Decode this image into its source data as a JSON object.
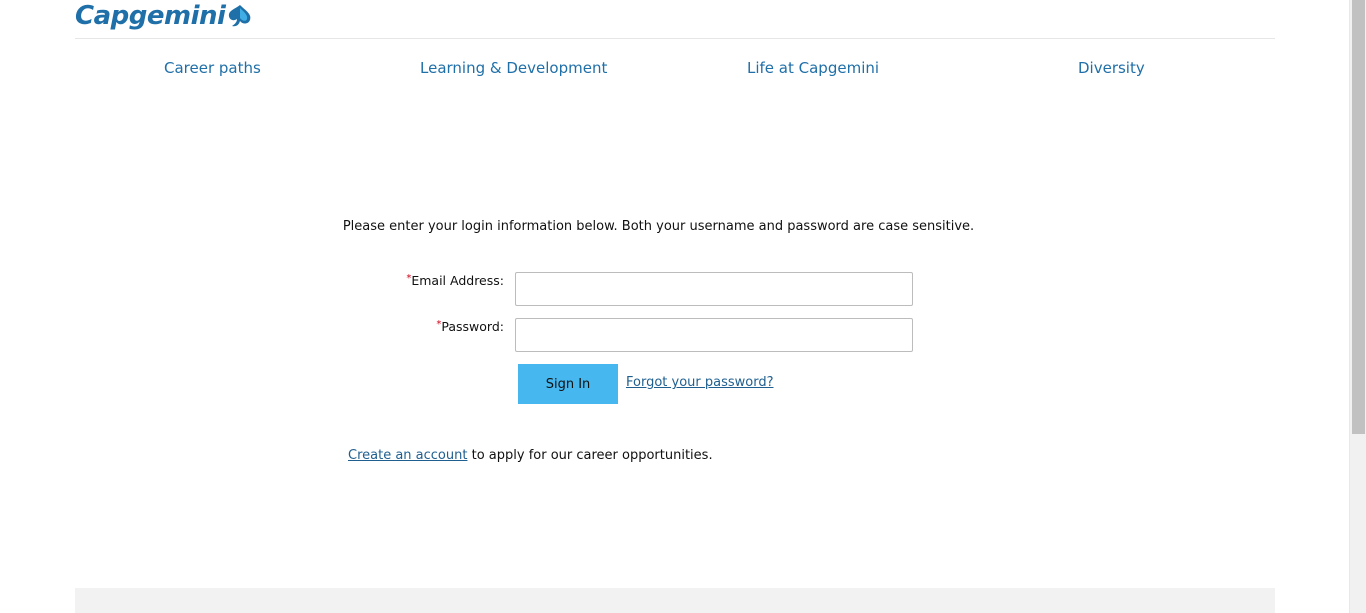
{
  "brand": {
    "logo_text": "Capgemini",
    "color": "#1f6fa8"
  },
  "nav": {
    "items": [
      {
        "label": "Career paths"
      },
      {
        "label": "Learning & Development"
      },
      {
        "label": "Life at Capgemini"
      },
      {
        "label": "Diversity"
      }
    ]
  },
  "login": {
    "intro": "Please enter your login information below. Both your username and password are case sensitive.",
    "required_marker": "*",
    "email_label": "Email Address:",
    "email_value": "",
    "password_label": "Password:",
    "password_value": "",
    "signin_label": "Sign In",
    "forgot_label": "Forgot your password?",
    "create_account_label": "Create an account",
    "create_account_suffix": " to apply for our career opportunities."
  },
  "colors": {
    "accent_button": "#46b8ef",
    "link": "#1f5f8f",
    "required": "#d0021b"
  },
  "icons": {
    "logo_mark": "spade-icon"
  }
}
